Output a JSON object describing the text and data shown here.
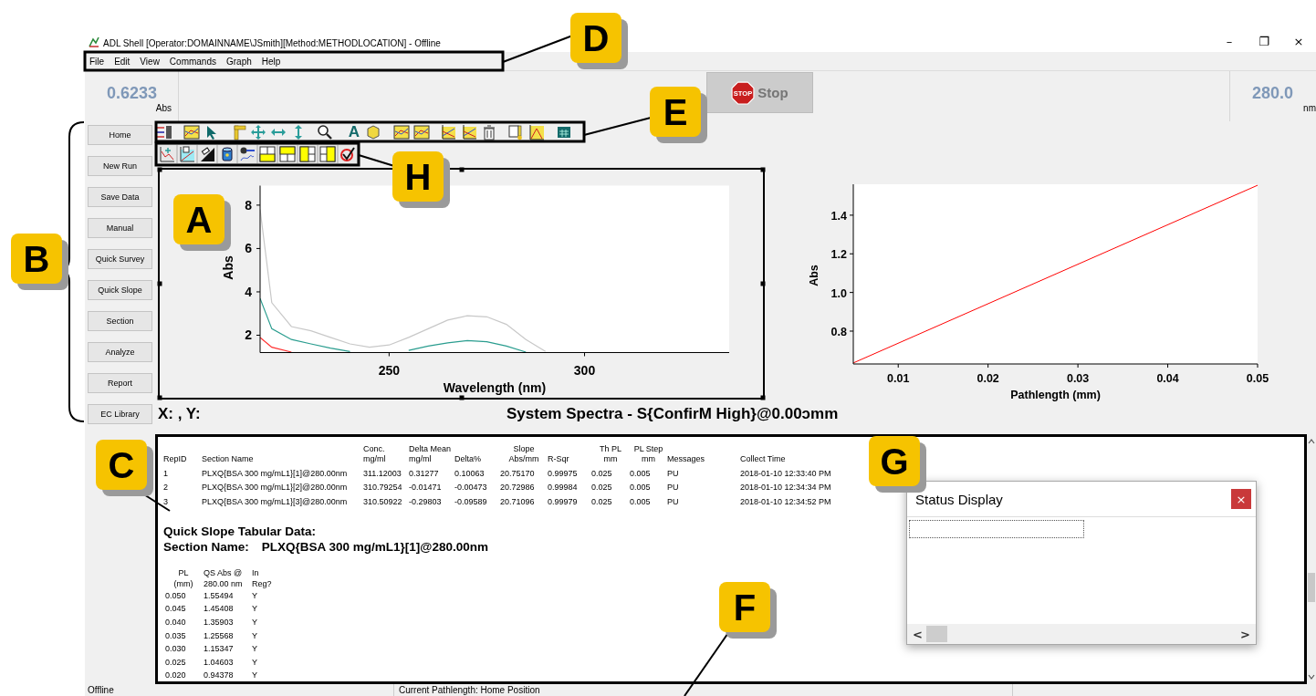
{
  "window": {
    "title": "ADL Shell [Operator:DOMAINNAME\\JSmith][Method:METHODLOCATION] - Offline",
    "controls": [
      "–",
      "❐",
      "×"
    ]
  },
  "menu": [
    "File",
    "Edit",
    "View",
    "Commands",
    "Graph",
    "Help"
  ],
  "readout_left": {
    "value": "0.6233",
    "unit": "Abs"
  },
  "stop_button": {
    "label": "Stop",
    "icon_text": "STOP",
    "disabled": true
  },
  "readout_right": {
    "value": "280.0",
    "unit": "nm"
  },
  "sidebar": {
    "items": [
      "Home",
      "New Run",
      "Save Data",
      "Manual",
      "Quick Survey",
      "Quick Slope",
      "Section",
      "Analyze",
      "Report",
      "EC Library"
    ]
  },
  "toolbar": {
    "text_tool": "A"
  },
  "spectrum_chart": {
    "chart_data": {
      "type": "line",
      "xlabel": "Wavelength (nm)",
      "ylabel": "Abs",
      "x": [
        217,
        220,
        225,
        230,
        235,
        240,
        245,
        250,
        255,
        260,
        265,
        270,
        275,
        280,
        285,
        290
      ],
      "xlim": [
        217,
        337
      ],
      "ylim": [
        1.2,
        8.9
      ],
      "xticks": [
        250,
        300
      ],
      "yticks": [
        2,
        4,
        6,
        8
      ],
      "series": [
        {
          "color": "#c8c8c8",
          "values": [
            7.8,
            3.5,
            2.4,
            2.2,
            1.9,
            1.6,
            1.45,
            1.55,
            1.9,
            2.3,
            2.7,
            2.9,
            2.85,
            2.5,
            1.8,
            1.25
          ]
        },
        {
          "color": "#2a9d8f",
          "values": [
            3.7,
            2.3,
            1.8,
            1.6,
            1.4,
            1.25,
            null,
            null,
            1.3,
            1.5,
            1.65,
            1.75,
            1.7,
            1.5,
            1.22,
            null
          ]
        },
        {
          "color": "#ff3030",
          "values": [
            1.9,
            1.45,
            1.22,
            null,
            null,
            null,
            null,
            null,
            null,
            null,
            null,
            null,
            null,
            null,
            null,
            null
          ]
        }
      ]
    }
  },
  "slope_chart": {
    "chart_data": {
      "type": "line",
      "xlabel": "Pathlength (mm)",
      "ylabel": "Abs",
      "x": [
        0.005,
        0.05
      ],
      "xlim": [
        0.005,
        0.05
      ],
      "ylim": [
        0.63,
        1.56
      ],
      "xticks": [
        0.01,
        0.02,
        0.03,
        0.04,
        0.05
      ],
      "yticks": [
        {
          "value": 0.8,
          "label": "0.8"
        },
        {
          "value": 1.0,
          "label": "1.0"
        },
        {
          "value": 1.2,
          "label": "1.2"
        },
        {
          "value": 1.4,
          "label": "1.4"
        }
      ],
      "series": [
        {
          "color": "#ff0000",
          "values": [
            0.635,
            1.555
          ]
        }
      ]
    }
  },
  "cursor_readout": "X: , Y:",
  "plot_title": "System Spectra - S{ConfirM High}@0.00ɔmm",
  "results_table": {
    "columns": [
      {
        "bottom": "RepID"
      },
      {
        "bottom": "Section Name"
      },
      {
        "top": "Conc.",
        "bottom": "mg/ml"
      },
      {
        "top": "Delta Mean",
        "bottom": "mg/ml"
      },
      {
        "bottom": "Delta%"
      },
      {
        "top": "Slope",
        "bottom": "Abs/mm"
      },
      {
        "bottom": "R-Sqr"
      },
      {
        "top": "Th PL",
        "bottom": "mm"
      },
      {
        "top": "PL Step",
        "bottom": "mm"
      },
      {
        "bottom": "Messages"
      },
      {
        "bottom": "Collect Time"
      }
    ],
    "rows": [
      [
        "1",
        "PLXQ{BSA 300 mg/mL1}[1]@280.00nm",
        "311.12003",
        "0.31277",
        "0.10063",
        "20.75170",
        "0.99975",
        "0.025",
        "0.005",
        "PU",
        "2018-01-10 12:33:40 PM"
      ],
      [
        "2",
        "PLXQ{BSA 300 mg/mL1}[2]@280.00nm",
        "310.79254",
        "-0.01471",
        "-0.00473",
        "20.72986",
        "0.99984",
        "0.025",
        "0.005",
        "PU",
        "2018-01-10 12:34:34 PM"
      ],
      [
        "3",
        "PLXQ{BSA 300 mg/mL1}[3]@280.00nm",
        "310.50922",
        "-0.29803",
        "-0.09589",
        "20.71096",
        "0.99979",
        "0.025",
        "0.005",
        "PU",
        "2018-01-10 12:34:52 PM"
      ]
    ]
  },
  "quick_slope": {
    "title": "Quick Slope Tabular Data:",
    "section_label": "Section Name:",
    "section_value": "PLXQ{BSA 300 mg/mL1}[1]@280.00nm",
    "columns": [
      {
        "top": "PL",
        "bottom": "(mm)"
      },
      {
        "top": "QS Abs @",
        "bottom": "280.00 nm"
      },
      {
        "top": "In",
        "bottom": "Reg?"
      }
    ],
    "rows": [
      [
        "0.050",
        "1.55494",
        "Y"
      ],
      [
        "0.045",
        "1.45408",
        "Y"
      ],
      [
        "0.040",
        "1.35903",
        "Y"
      ],
      [
        "0.035",
        "1.25568",
        "Y"
      ],
      [
        "0.030",
        "1.15347",
        "Y"
      ],
      [
        "0.025",
        "1.04603",
        "Y"
      ],
      [
        "0.020",
        "0.94378",
        "Y"
      ]
    ]
  },
  "status_window": {
    "title": "Status Display",
    "close": "×",
    "scroll_left": "<",
    "scroll_right": ">"
  },
  "status_bar": [
    "Offline",
    "Current Pathlength: Home Position"
  ],
  "callouts": [
    "A",
    "B",
    "C",
    "D",
    "E",
    "F",
    "G",
    "H"
  ]
}
